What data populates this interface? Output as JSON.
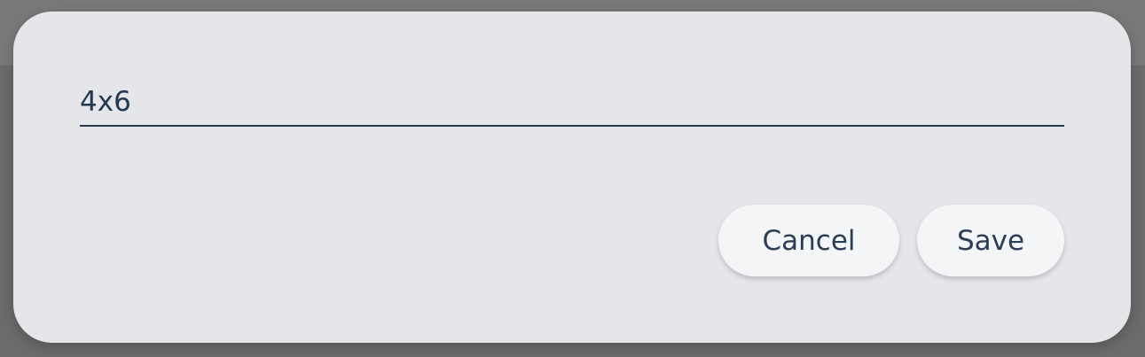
{
  "dialog": {
    "input_value": "4x6"
  },
  "actions": {
    "cancel_label": "Cancel",
    "save_label": "Save"
  },
  "colors": {
    "text": "#243850",
    "dialog_background": "#e5e6ea",
    "button_background": "#f4f5f7",
    "overlay": "#6b6b6b"
  }
}
